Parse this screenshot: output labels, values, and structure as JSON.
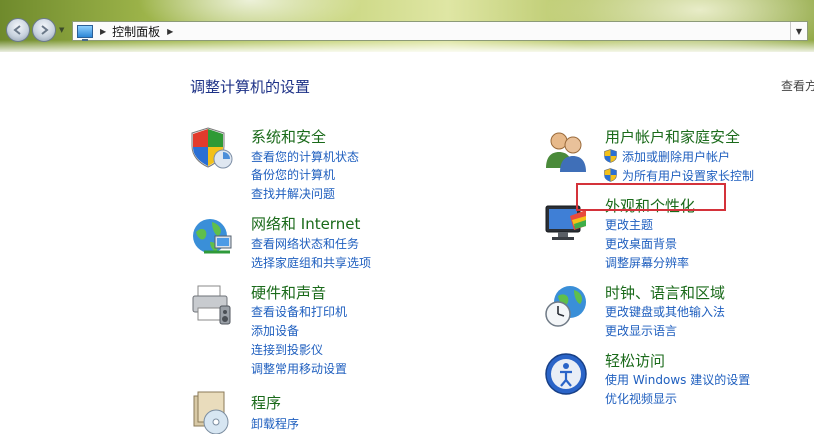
{
  "window": {
    "breadcrumb": "控制面板"
  },
  "page": {
    "title": "调整计算机的设置",
    "view_by": "查看方"
  },
  "categories": {
    "system_security": {
      "title": "系统和安全",
      "links": [
        "查看您的计算机状态",
        "备份您的计算机",
        "查找并解决问题"
      ]
    },
    "network": {
      "title": "网络和 Internet",
      "links": [
        "查看网络状态和任务",
        "选择家庭组和共享选项"
      ]
    },
    "hardware": {
      "title": "硬件和声音",
      "links": [
        "查看设备和打印机",
        "添加设备",
        "连接到投影仪",
        "调整常用移动设置"
      ]
    },
    "programs": {
      "title": "程序",
      "links": [
        "卸载程序"
      ]
    },
    "user_accounts": {
      "title": "用户帐户和家庭安全",
      "links": [
        "添加或删除用户帐户",
        "为所有用户设置家长控制"
      ]
    },
    "appearance": {
      "title": "外观和个性化",
      "links": [
        "更改主题",
        "更改桌面背景",
        "调整屏幕分辨率"
      ]
    },
    "clock": {
      "title": "时钟、语言和区域",
      "links": [
        "更改键盘或其他输入法",
        "更改显示语言"
      ]
    },
    "ease": {
      "title": "轻松访问",
      "links": [
        "使用 Windows 建议的设置",
        "优化视频显示"
      ]
    }
  },
  "colors": {
    "category_title": "#1a6a1a",
    "link": "#1f5fbf",
    "page_title": "#1e3287",
    "highlight": "#d4323a"
  }
}
